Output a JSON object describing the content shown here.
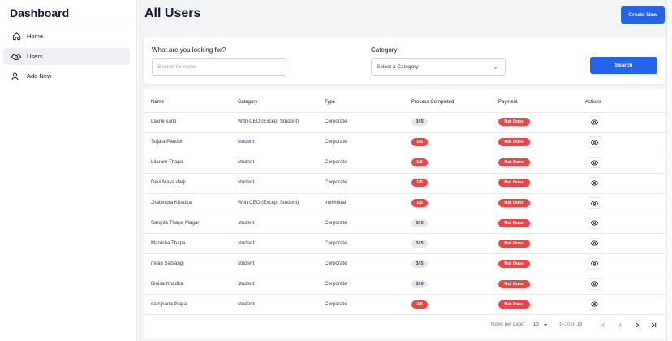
{
  "sidebar": {
    "brand": "Dashboard",
    "items": [
      {
        "label": "Home",
        "icon": "home-icon"
      },
      {
        "label": "Users",
        "icon": "eye-icon",
        "active": true
      },
      {
        "label": "Add New",
        "icon": "add-user-icon"
      }
    ]
  },
  "header": {
    "title": "All Users",
    "create_label": "Create New"
  },
  "filters": {
    "search_label": "What are you looking for?",
    "search_placeholder": "Search for name",
    "category_label": "Category",
    "category_value": "Select a Category",
    "search_button": "Search"
  },
  "table": {
    "columns": [
      "Name",
      "Category",
      "Type",
      "Process Completed",
      "Payment",
      "Actions"
    ],
    "rows": [
      {
        "name": "Laxmi karki",
        "category": "With CEO (Except Student)",
        "type": "Corporate",
        "process": "3/ 5",
        "process_status": "grey",
        "payment": "Not Done"
      },
      {
        "name": "Sujata Paudel",
        "category": "student",
        "type": "Corporate",
        "process": "1/5",
        "process_status": "red",
        "payment": "Not Done"
      },
      {
        "name": "Lilaram Thapa",
        "category": "student",
        "type": "Corporate",
        "process": "1/5",
        "process_status": "red",
        "payment": "Not Done"
      },
      {
        "name": "Devi Maya darji",
        "category": "student",
        "type": "Corporate",
        "process": "1/5",
        "process_status": "red",
        "payment": "Not Done"
      },
      {
        "name": "Jhabindra Khadka",
        "category": "With CEO (Except Student)",
        "type": "Individual",
        "process": "1/5",
        "process_status": "red",
        "payment": "Not Done"
      },
      {
        "name": "Sangita Thapa Magar",
        "category": "student",
        "type": "Corporate",
        "process": "3/ 5",
        "process_status": "grey",
        "payment": "Not Done"
      },
      {
        "name": "Manisha Thapa",
        "category": "student",
        "type": "Corporate",
        "process": "3/ 5",
        "process_status": "grey",
        "payment": "Not Done"
      },
      {
        "name": "milan Saplangi",
        "category": "student",
        "type": "Corporate",
        "process": "3/ 5",
        "process_status": "grey",
        "payment": "Not Done"
      },
      {
        "name": "Binisa Khadka",
        "category": "student",
        "type": "Corporate",
        "process": "3/ 5",
        "process_status": "grey",
        "payment": "Not Done"
      },
      {
        "name": "samjhana thapa",
        "category": "student",
        "type": "Corporate",
        "process": "2/5",
        "process_status": "red",
        "payment": "Not Done"
      }
    ]
  },
  "pagination": {
    "rows_per_page_label": "Rows per page:",
    "rows_per_page_value": "10",
    "range": "1–10 of 18"
  },
  "colors": {
    "accent": "#2563eb",
    "danger": "#ef4444",
    "neutral_badge": "#e5e7eb"
  }
}
